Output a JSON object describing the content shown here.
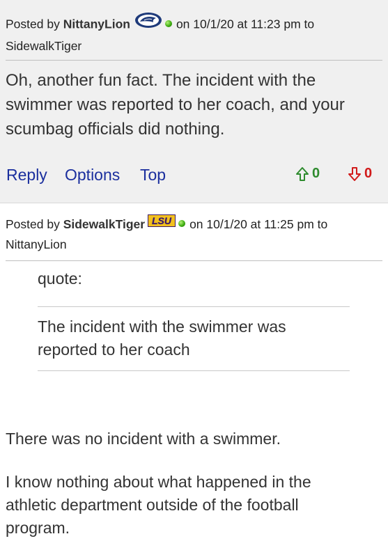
{
  "posts": [
    {
      "posted_by_label": "Posted by",
      "username": "NittanyLion",
      "team_logo_icon": "penn-state-logo",
      "online_status_color": "#3fae12",
      "on_label": "on",
      "timestamp": "10/1/20 at 11:23 pm",
      "to_label": "to",
      "recipient": "SidewalkTiger",
      "body": "Oh, another fun fact. The incident with the swimmer was reported to her coach, and your scumbag officials did nothing.",
      "actions": {
        "reply": "Reply",
        "options": "Options",
        "top": "Top",
        "upvotes": "0",
        "downvotes": "0"
      }
    },
    {
      "posted_by_label": "Posted by",
      "username": "SidewalkTiger",
      "team_logo_icon": "lsu-logo",
      "team_logo_text": "LSU",
      "online_status_color": "#3fae12",
      "on_label": "on",
      "timestamp": "10/1/20 at 11:25 pm",
      "to_label": "to",
      "recipient": "NittanyLion",
      "quote_label": "quote:",
      "quote_text": "The incident with the swimmer was reported to her coach",
      "paragraphs": [
        "There was no incident with a swimmer.",
        "I know nothing about what happened in the athletic department outside of the football program."
      ]
    }
  ],
  "colors": {
    "link": "#1b2f9e",
    "upvote": "#2e8b2e",
    "downvote": "#d11a1a",
    "lsu_gold": "#f2c01e",
    "lsu_purple": "#3d1b6b",
    "psu_navy": "#1e3a7a"
  }
}
